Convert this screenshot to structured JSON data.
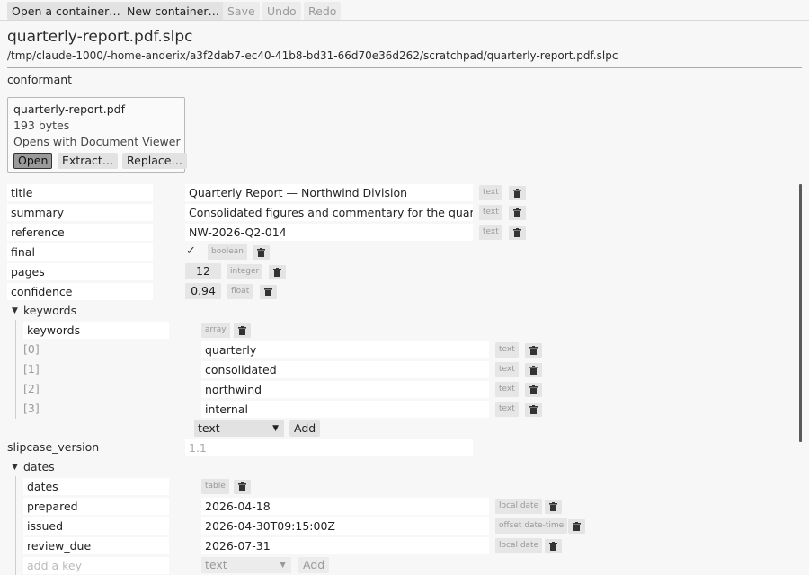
{
  "toolbar": {
    "open_container": "Open a container…",
    "new_container": "New container…",
    "save": "Save",
    "undo": "Undo",
    "redo": "Redo"
  },
  "document": {
    "filename": "quarterly-report.pdf.slpc",
    "path": "/tmp/claude-1000/-home-anderix/a3f2dab7-ec40-41b8-bd31-66d70e36d262/scratchpad/quarterly-report.pdf.slpc",
    "status": "conformant"
  },
  "attachment": {
    "name": "quarterly-report.pdf",
    "size": "193 bytes",
    "opens_with": "Opens with Document Viewer",
    "open_label": "Open",
    "extract_label": "Extract…",
    "replace_label": "Replace…"
  },
  "fields": [
    {
      "key": "title",
      "value": "Quarterly Report — Northwind Division",
      "type": "text"
    },
    {
      "key": "summary",
      "value": "Consolidated figures and commentary for the quarter.",
      "type": "text"
    },
    {
      "key": "reference",
      "value": "NW-2026-Q2-014",
      "type": "text"
    },
    {
      "key": "final",
      "value": "✓",
      "type": "boolean"
    },
    {
      "key": "pages",
      "value": "12",
      "type": "integer"
    },
    {
      "key": "confidence",
      "value": "0.94",
      "type": "float"
    }
  ],
  "keywords": {
    "section": "keywords",
    "key": "keywords",
    "type": "array",
    "items": [
      {
        "index": "[0]",
        "value": "quarterly",
        "type": "text"
      },
      {
        "index": "[1]",
        "value": "consolidated",
        "type": "text"
      },
      {
        "index": "[2]",
        "value": "northwind",
        "type": "text"
      },
      {
        "index": "[3]",
        "value": "internal",
        "type": "text"
      }
    ],
    "add_type": "text",
    "add_label": "Add"
  },
  "slipcase_version": {
    "key": "slipcase_version",
    "value": "1.1"
  },
  "dates": {
    "section": "dates",
    "key": "dates",
    "type": "table",
    "items": [
      {
        "key": "prepared",
        "value": "2026-04-18",
        "type": "local date"
      },
      {
        "key": "issued",
        "value": "2026-04-30T09:15:00Z",
        "type": "offset date-time"
      },
      {
        "key": "review_due",
        "value": "2026-07-31",
        "type": "local date"
      }
    ],
    "add_key_placeholder": "add a key",
    "add_type": "text",
    "add_label": "Add"
  },
  "icons": {
    "trash": "trash-icon",
    "expand": "triangle-down-icon",
    "dropdown": "chevron-down-icon"
  }
}
